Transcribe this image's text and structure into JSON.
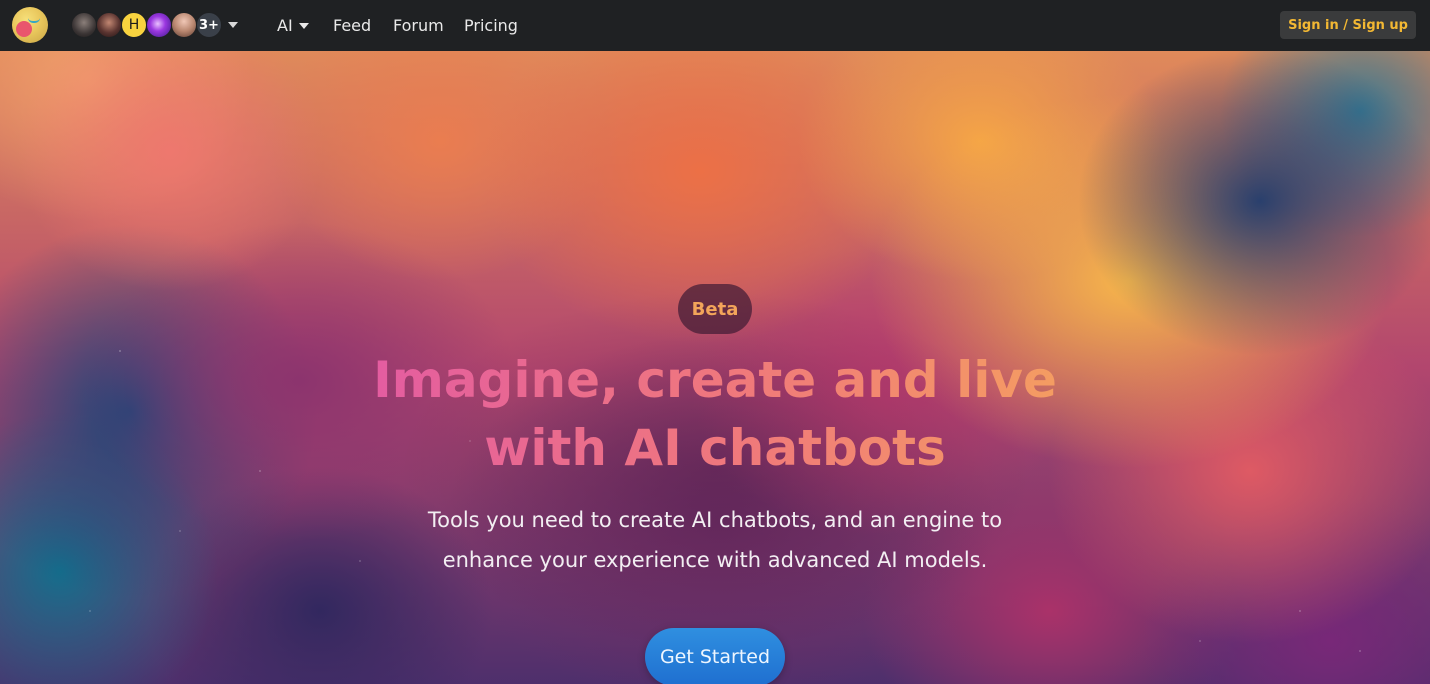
{
  "nav": {
    "items": [
      {
        "label": "AI",
        "has_dropdown": true
      },
      {
        "label": "Feed"
      },
      {
        "label": "Forum"
      },
      {
        "label": "Pricing"
      }
    ],
    "avatars": [
      {
        "name": "user-avatar-1"
      },
      {
        "name": "user-avatar-2"
      },
      {
        "name": "user-avatar-h",
        "initial": "H"
      },
      {
        "name": "user-avatar-4"
      },
      {
        "name": "user-avatar-5"
      }
    ],
    "more_count": "3+",
    "signin_label": "Sign in / Sign up"
  },
  "hero": {
    "badge": "Beta",
    "headline_line1": "Imagine, create and live",
    "headline_line2": "with AI chatbots",
    "subtext_line1": "Tools you need to create AI chatbots, and an engine to",
    "subtext_line2": "enhance your experience with advanced AI models.",
    "cta_label": "Get Started"
  },
  "colors": {
    "topbar": "#1f2123",
    "signin_text": "#f3b833",
    "cta": "#2a82db",
    "badge_text": "#f3a55a"
  }
}
